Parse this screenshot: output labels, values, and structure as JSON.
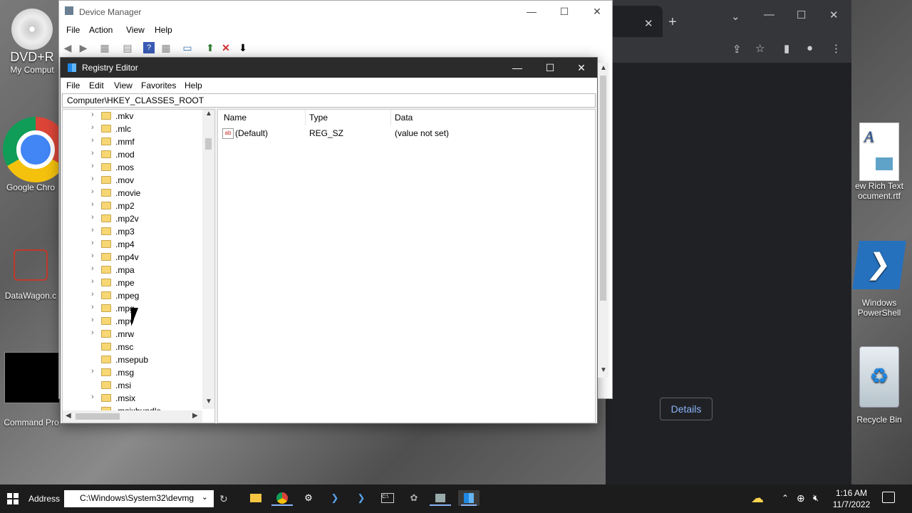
{
  "desktop": {
    "icons": [
      {
        "label": "DVD+R",
        "sublabel": "My Comput"
      },
      {
        "label": "Google Chro"
      },
      {
        "label": "DataWagon.c"
      },
      {
        "label": "Command Pro"
      },
      {
        "label": "ew Rich Text",
        "sublabel": "ocument.rtf"
      },
      {
        "label": "Windows",
        "sublabel": "PowerShell"
      },
      {
        "label": "Recycle Bin"
      }
    ]
  },
  "chrome": {
    "details_label": "Details"
  },
  "device_manager": {
    "title": "Device Manager",
    "menu": [
      "File",
      "Action",
      "View",
      "Help"
    ]
  },
  "registry_editor": {
    "title": "Registry Editor",
    "menu": [
      "File",
      "Edit",
      "View",
      "Favorites",
      "Help"
    ],
    "address": "Computer\\HKEY_CLASSES_ROOT",
    "tree": [
      {
        "label": ".mkv",
        "expandable": true
      },
      {
        "label": ".mlc",
        "expandable": true
      },
      {
        "label": ".mmf",
        "expandable": true
      },
      {
        "label": ".mod",
        "expandable": true
      },
      {
        "label": ".mos",
        "expandable": true
      },
      {
        "label": ".mov",
        "expandable": true
      },
      {
        "label": ".movie",
        "expandable": true
      },
      {
        "label": ".mp2",
        "expandable": true
      },
      {
        "label": ".mp2v",
        "expandable": true
      },
      {
        "label": ".mp3",
        "expandable": true
      },
      {
        "label": ".mp4",
        "expandable": true
      },
      {
        "label": ".mp4v",
        "expandable": true
      },
      {
        "label": ".mpa",
        "expandable": true
      },
      {
        "label": ".mpe",
        "expandable": true
      },
      {
        "label": ".mpeg",
        "expandable": true
      },
      {
        "label": ".mpg",
        "expandable": true
      },
      {
        "label": ".mpv",
        "expandable": true
      },
      {
        "label": ".mrw",
        "expandable": true
      },
      {
        "label": ".msc",
        "expandable": false
      },
      {
        "label": ".msepub",
        "expandable": false
      },
      {
        "label": ".msg",
        "expandable": true
      },
      {
        "label": ".msi",
        "expandable": false
      },
      {
        "label": ".msix",
        "expandable": true
      },
      {
        "label": ".msixbundle",
        "expandable": false
      }
    ],
    "columns": [
      "Name",
      "Type",
      "Data"
    ],
    "values": [
      {
        "name": "(Default)",
        "type": "REG_SZ",
        "data": "(value not set)"
      }
    ]
  },
  "taskbar": {
    "address_label": "Address",
    "address_value": "C:\\Windows\\System32\\devmg",
    "time": "1:16 AM",
    "date": "11/7/2022"
  }
}
